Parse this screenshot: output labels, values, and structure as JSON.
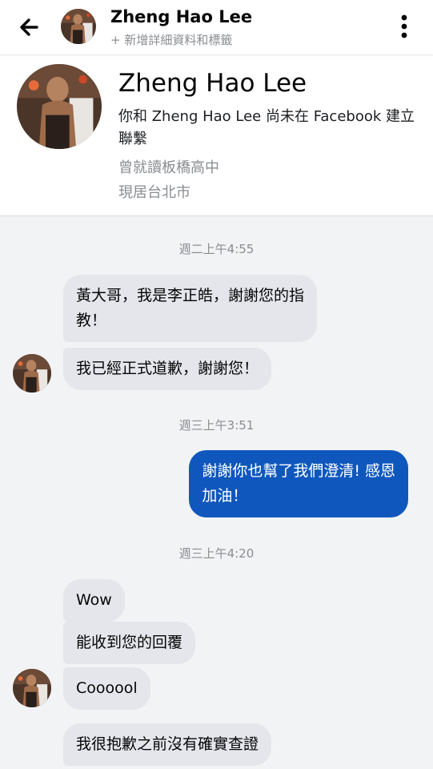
{
  "header": {
    "name": "Zheng Hao Lee",
    "subtitle": "+ 新增詳細資料和標籤"
  },
  "profile": {
    "name": "Zheng Hao Lee",
    "description": "你和 Zheng Hao Lee 尚未在 Facebook 建立聯繫",
    "school": "曾就讀板橋高中",
    "city": "現居台北市"
  },
  "timestamps": [
    "週二上午4:55",
    "週三上午3:51",
    "週三上午4:20"
  ],
  "messages": [
    {
      "direction": "incoming",
      "text_lines": [
        "黃大哥，我是李正皓，謝謝您的指",
        "教！"
      ]
    },
    {
      "direction": "incoming",
      "text": "我已經正式道歉，謝謝您！"
    },
    {
      "direction": "outgoing",
      "text_lines": [
        "謝謝你也幫了我們澄清! 感恩",
        "加油！"
      ]
    },
    {
      "direction": "incoming",
      "text": "Wow"
    },
    {
      "direction": "incoming",
      "text": "能收到您的回覆"
    },
    {
      "direction": "incoming",
      "text": "Coooool"
    },
    {
      "direction": "incoming",
      "text": "我很抱歉之前沒有確實查證"
    }
  ],
  "icons": {
    "back": "back-arrow-icon",
    "more": "more-vertical-icon"
  },
  "colors": {
    "incoming_bubble": "#e4e6eb",
    "outgoing_bubble": "#0f57bd",
    "chat_background": "#f2f3f5",
    "secondary_text": "#8a8d91"
  }
}
